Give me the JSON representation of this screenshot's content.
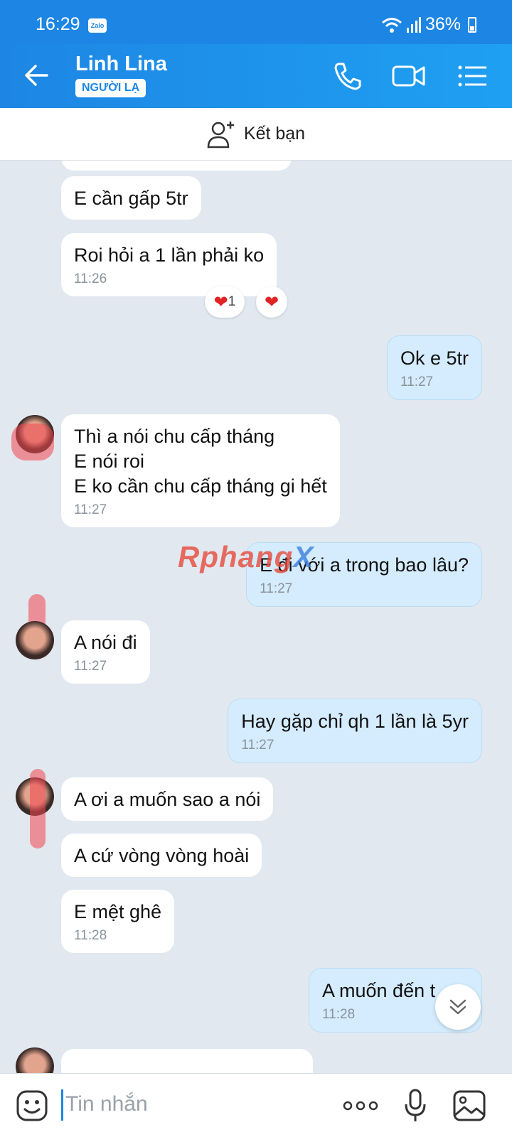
{
  "status_bar": {
    "time": "16:29",
    "app_badge": "Zalo",
    "battery": "36%"
  },
  "header": {
    "name": "Linh Lina",
    "badge": "NGƯỜI LẠ"
  },
  "add_friend": {
    "label": "Kết bạn"
  },
  "messages": [
    {
      "side": "in",
      "text": "E cần gấp 5tr"
    },
    {
      "side": "in",
      "text": "Roi hỏi a 1 lần phải ko",
      "time": "11:26"
    },
    {
      "side": "out",
      "text": "Ok e 5tr",
      "time": "11:27"
    },
    {
      "side": "in",
      "lines": [
        "Thì a nói chu cấp tháng",
        "E nói roi",
        "E ko cần chu cấp tháng gi hết"
      ],
      "time": "11:27"
    },
    {
      "side": "out",
      "text": "E đi với a trong bao lâu?",
      "time": "11:27"
    },
    {
      "side": "in",
      "text": "A nói đi",
      "time": "11:27"
    },
    {
      "side": "out",
      "text": "Hay gặp chỉ qh 1 lần là 5yr",
      "time": "11:27"
    },
    {
      "side": "in",
      "text": "A ơi a muốn sao a nói"
    },
    {
      "side": "in",
      "text": "A cứ vòng vòng hoài"
    },
    {
      "side": "in",
      "text": "E mệt ghê",
      "time": "11:28"
    },
    {
      "side": "out",
      "text": "A muốn đến t",
      "time": "11:28"
    }
  ],
  "reaction": {
    "count": "1"
  },
  "watermark": {
    "part1": "Rphang",
    "part2": "X"
  },
  "input": {
    "placeholder": "Tin nhắn"
  },
  "colors": {
    "primary": "#1d86e4",
    "outgoing_bubble": "#d4ecfd",
    "incoming_bubble": "#ffffff",
    "chat_bg": "#e2e8f0"
  }
}
